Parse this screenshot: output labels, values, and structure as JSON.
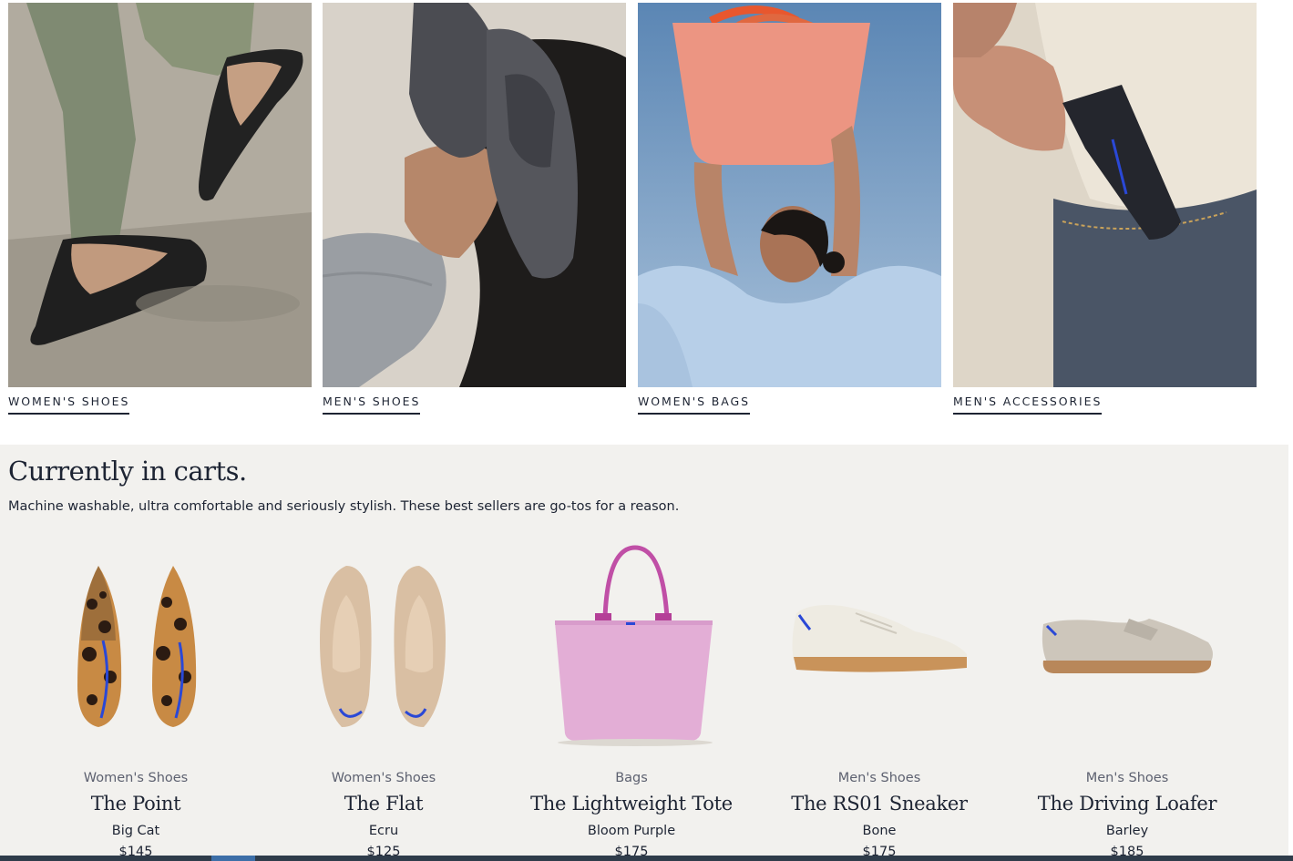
{
  "categories": [
    {
      "label": "WOMEN'S SHOES"
    },
    {
      "label": "MEN'S SHOES"
    },
    {
      "label": "WOMEN'S BAGS"
    },
    {
      "label": "MEN'S ACCESSORIES"
    }
  ],
  "carts": {
    "title": "Currently in carts.",
    "subtitle": "Machine washable, ultra comfortable and seriously stylish. These best sellers are go-tos for a reason.",
    "products": [
      {
        "category": "Women's Shoes",
        "name": "The Point",
        "color": "Big Cat",
        "price": "$145"
      },
      {
        "category": "Women's Shoes",
        "name": "The Flat",
        "color": "Ecru",
        "price": "$125"
      },
      {
        "category": "Bags",
        "name": "The Lightweight Tote",
        "color": "Bloom Purple",
        "price": "$175"
      },
      {
        "category": "Men's Shoes",
        "name": "The RS01 Sneaker",
        "color": "Bone",
        "price": "$175"
      },
      {
        "category": "Men's Shoes",
        "name": "The Driving Loafer",
        "color": "Barley",
        "price": "$185"
      }
    ]
  },
  "colors": {
    "ink": "#1d2433",
    "section_bg": "#f2f1ee",
    "accent_blue": "#2a48d6"
  }
}
